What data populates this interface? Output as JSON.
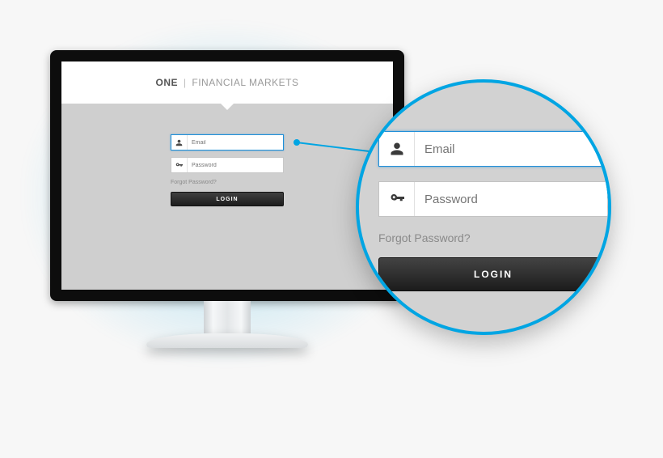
{
  "brand": {
    "one": "ONE",
    "separator": "|",
    "rest": "FINANCIAL MARKETS"
  },
  "form": {
    "email_placeholder": "Email",
    "password_placeholder": "Password",
    "forgot_label": "Forgot Password?",
    "login_label": "LOGIN"
  },
  "icons": {
    "user": "user-icon",
    "key": "key-icon"
  }
}
